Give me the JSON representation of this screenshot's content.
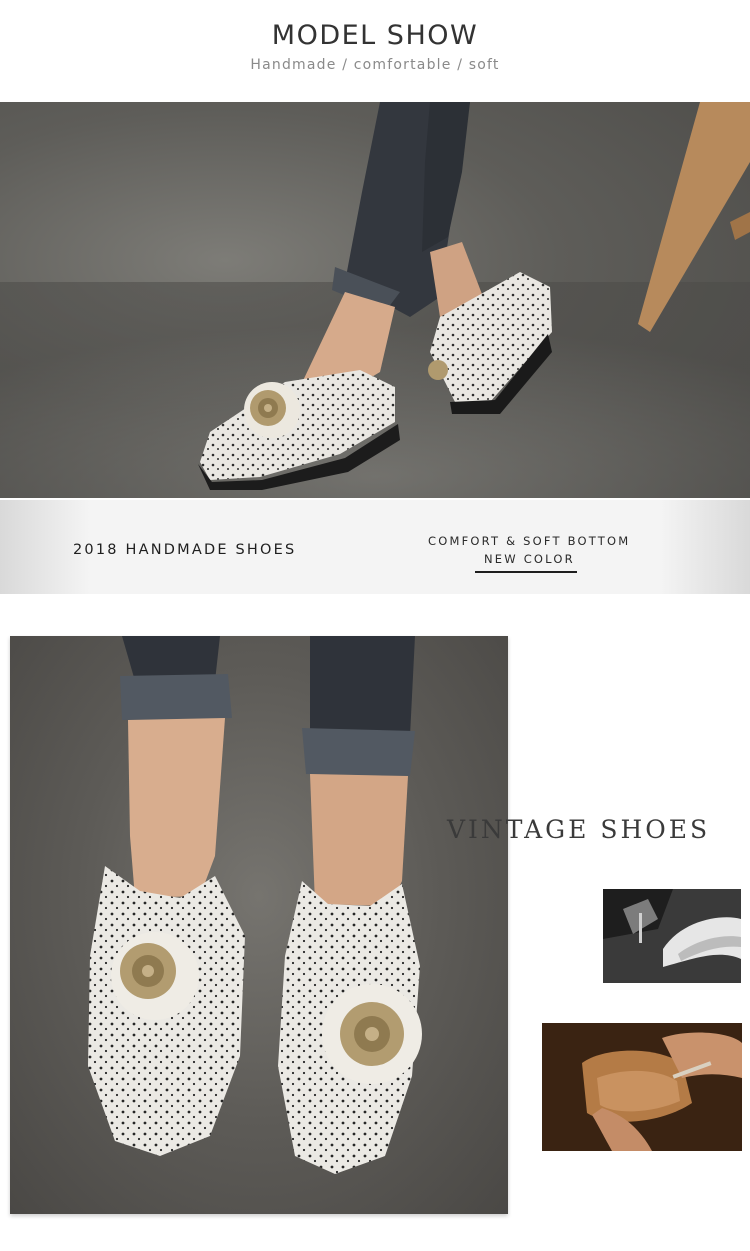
{
  "header": {
    "title": "MODEL SHOW",
    "subtitle": "Handmade / comfortable / soft"
  },
  "banner": {
    "left_text": "2018 HANDMADE SHOES",
    "right_line1": "COMFORT & SOFT BOTTOM",
    "right_line2": "NEW COLOR"
  },
  "vintage": {
    "text": "VINTAGE SHOES"
  },
  "images": {
    "top_photo": "model-wearing-white-floral-mules-side-view",
    "main_photo": "model-wearing-white-floral-mules-front-view",
    "small_photo_1": "sewing-machine-stitching-leather",
    "small_photo_2": "hands-crafting-leather-shoe"
  },
  "colors": {
    "background": "#ffffff",
    "text_dark": "#333333",
    "text_muted": "#8a8a8a",
    "banner_bg": "#f4f4f4"
  }
}
